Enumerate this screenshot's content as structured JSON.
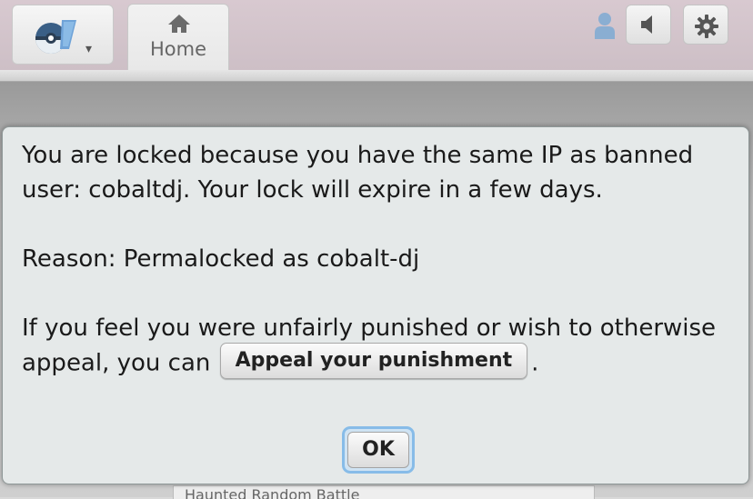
{
  "header": {
    "logo_icon": "pokeball-logo-icon",
    "logo_caret": "▾",
    "home_tab": {
      "label": "Home",
      "icon": "home-icon"
    },
    "user_icon": "user-icon",
    "volume_icon": "volume-icon",
    "settings_icon": "gear-icon"
  },
  "background": {
    "room_title": "Haunted Random Battle"
  },
  "popup": {
    "line1": "You are locked because you have the same IP as banned user: cobaltdj. Your lock will expire in a few days.",
    "line2": "Reason: Permalocked as cobalt-dj",
    "line3_prefix": "If you feel you were unfairly punished or wish to otherwise appeal, you can",
    "appeal_button": "Appeal your punishment",
    "line3_suffix": ".",
    "ok_button": "OK"
  },
  "colors": {
    "header_bg": "#d8c9d0",
    "popup_bg": "#e5e9e9",
    "ok_focus_ring": "#87bce8"
  }
}
